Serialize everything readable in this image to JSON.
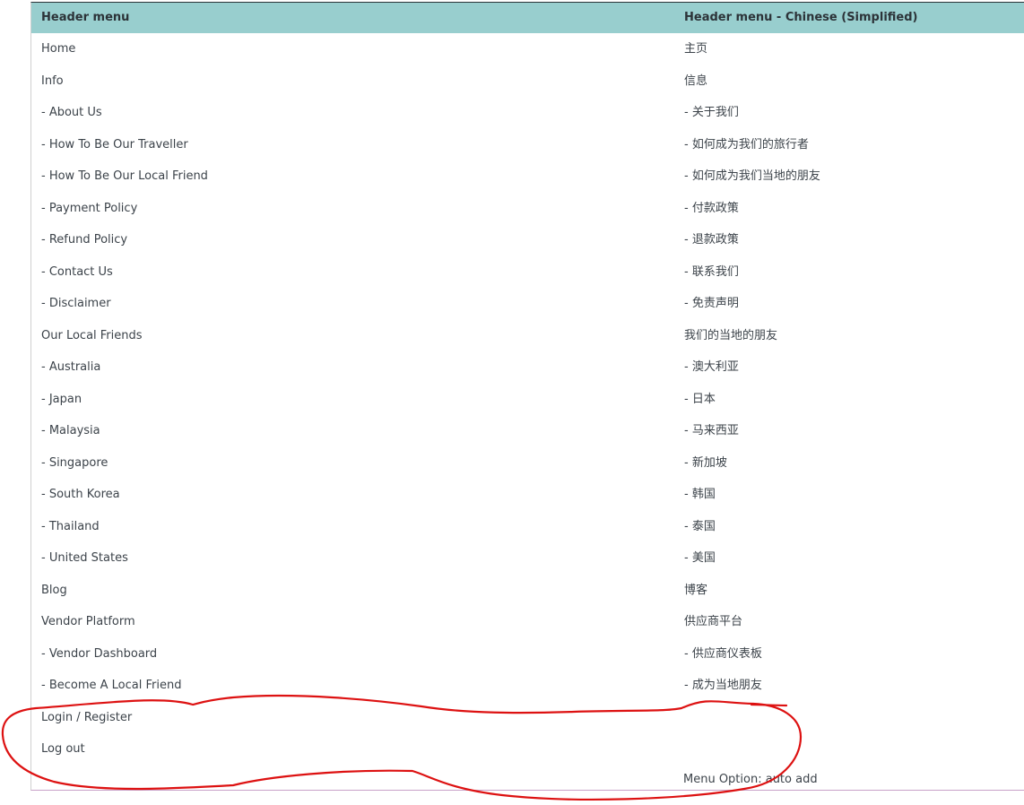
{
  "table": {
    "header_left": "Header menu",
    "header_right": "Header menu - Chinese (Simplified)",
    "rows": [
      {
        "en": "Home",
        "zh": "主页"
      },
      {
        "en": "Info",
        "zh": "信息"
      },
      {
        "en": "- About Us",
        "zh": "- 关于我们"
      },
      {
        "en": "- How To Be Our Traveller",
        "zh": "- 如何成为我们的旅行者"
      },
      {
        "en": "- How To Be Our Local Friend",
        "zh": "- 如何成为我们当地的朋友"
      },
      {
        "en": "- Payment Policy",
        "zh": "- 付款政策"
      },
      {
        "en": "- Refund Policy",
        "zh": "- 退款政策"
      },
      {
        "en": "- Contact Us",
        "zh": "- 联系我们"
      },
      {
        "en": "- Disclaimer",
        "zh": "- 免责声明"
      },
      {
        "en": "Our Local Friends",
        "zh": "我们的当地的朋友"
      },
      {
        "en": "- Australia",
        "zh": "- 澳大利亚"
      },
      {
        "en": "- Japan",
        "zh": "- 日本"
      },
      {
        "en": "- Malaysia",
        "zh": "- 马来西亚"
      },
      {
        "en": "- Singapore",
        "zh": "- 新加坡"
      },
      {
        "en": "- South Korea",
        "zh": "- 韩国"
      },
      {
        "en": "- Thailand",
        "zh": "- 泰国"
      },
      {
        "en": "- United States",
        "zh": "- 美国"
      },
      {
        "en": "Blog",
        "zh": "博客"
      },
      {
        "en": "Vendor Platform",
        "zh": "供应商平台"
      },
      {
        "en": "- Vendor Dashboard",
        "zh": "- 供应商仪表板"
      },
      {
        "en": "- Become A Local Friend",
        "zh": "- 成为当地朋友"
      },
      {
        "en": "Login / Register",
        "zh": ""
      },
      {
        "en": "Log out",
        "zh": ""
      }
    ],
    "menu_option": "Menu Option: auto add"
  },
  "colors": {
    "header_bg": "#98cece",
    "annotation_red": "#dd1111"
  }
}
